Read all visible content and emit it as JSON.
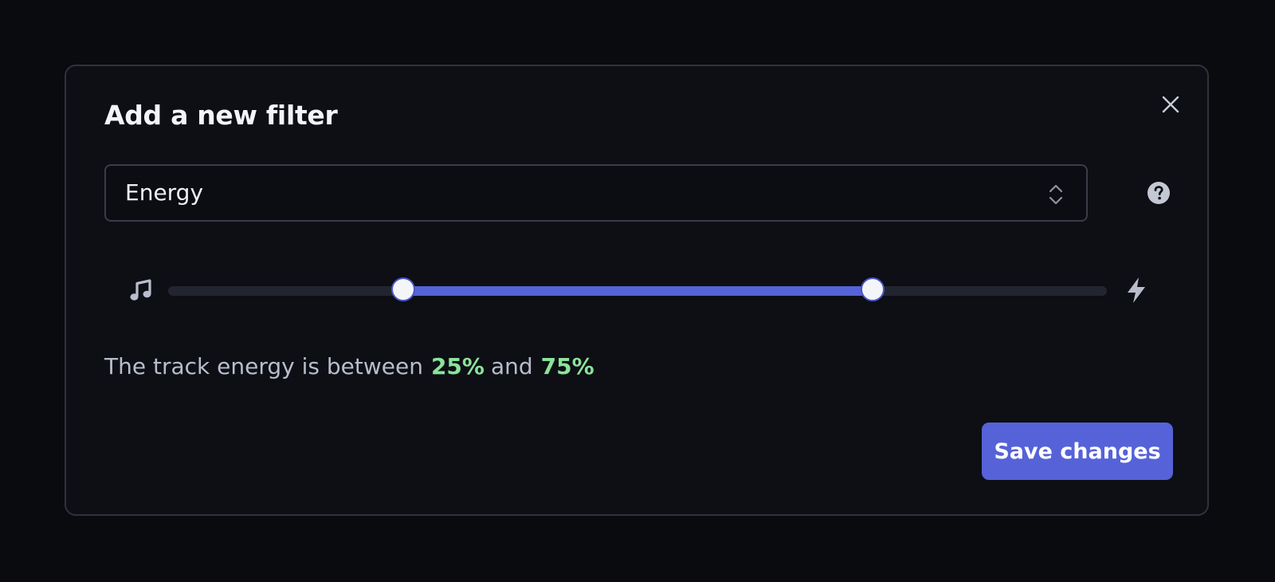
{
  "modal": {
    "title": "Add a new filter",
    "close_icon": "close-icon"
  },
  "filter_select": {
    "selected": "Energy",
    "icon": "chevron-up-down-icon"
  },
  "help": {
    "icon": "question-circle-icon"
  },
  "slider": {
    "min_icon": "music-note-icon",
    "max_icon": "lightning-bolt-icon",
    "low": 25,
    "high": 75,
    "accent_color": "#5662d8"
  },
  "summary": {
    "prefix": "The track energy is between",
    "low_text": "25%",
    "conjunction": "and",
    "high_text": "75%",
    "value_color": "#8be39a"
  },
  "actions": {
    "save_label": "Save changes"
  }
}
